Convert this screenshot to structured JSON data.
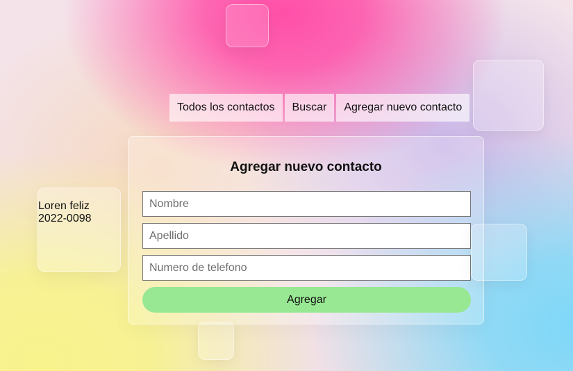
{
  "nav": {
    "tabs": [
      {
        "label": "Todos los contactos"
      },
      {
        "label": "Buscar"
      },
      {
        "label": "Agregar nuevo contacto"
      }
    ]
  },
  "sidebar_card": {
    "line1": "Loren feliz",
    "line2": "2022-0098"
  },
  "form": {
    "title": "Agregar nuevo contacto",
    "fields": [
      {
        "placeholder": "Nombre",
        "value": ""
      },
      {
        "placeholder": "Apellido",
        "value": ""
      },
      {
        "placeholder": "Numero de telefono",
        "value": ""
      }
    ],
    "submit_label": "Agregar"
  },
  "colors": {
    "submit_button": "#98e893",
    "background_pink": "#ff4fa8",
    "background_blue": "#7fd8f8",
    "background_yellow": "#f8f38c"
  }
}
